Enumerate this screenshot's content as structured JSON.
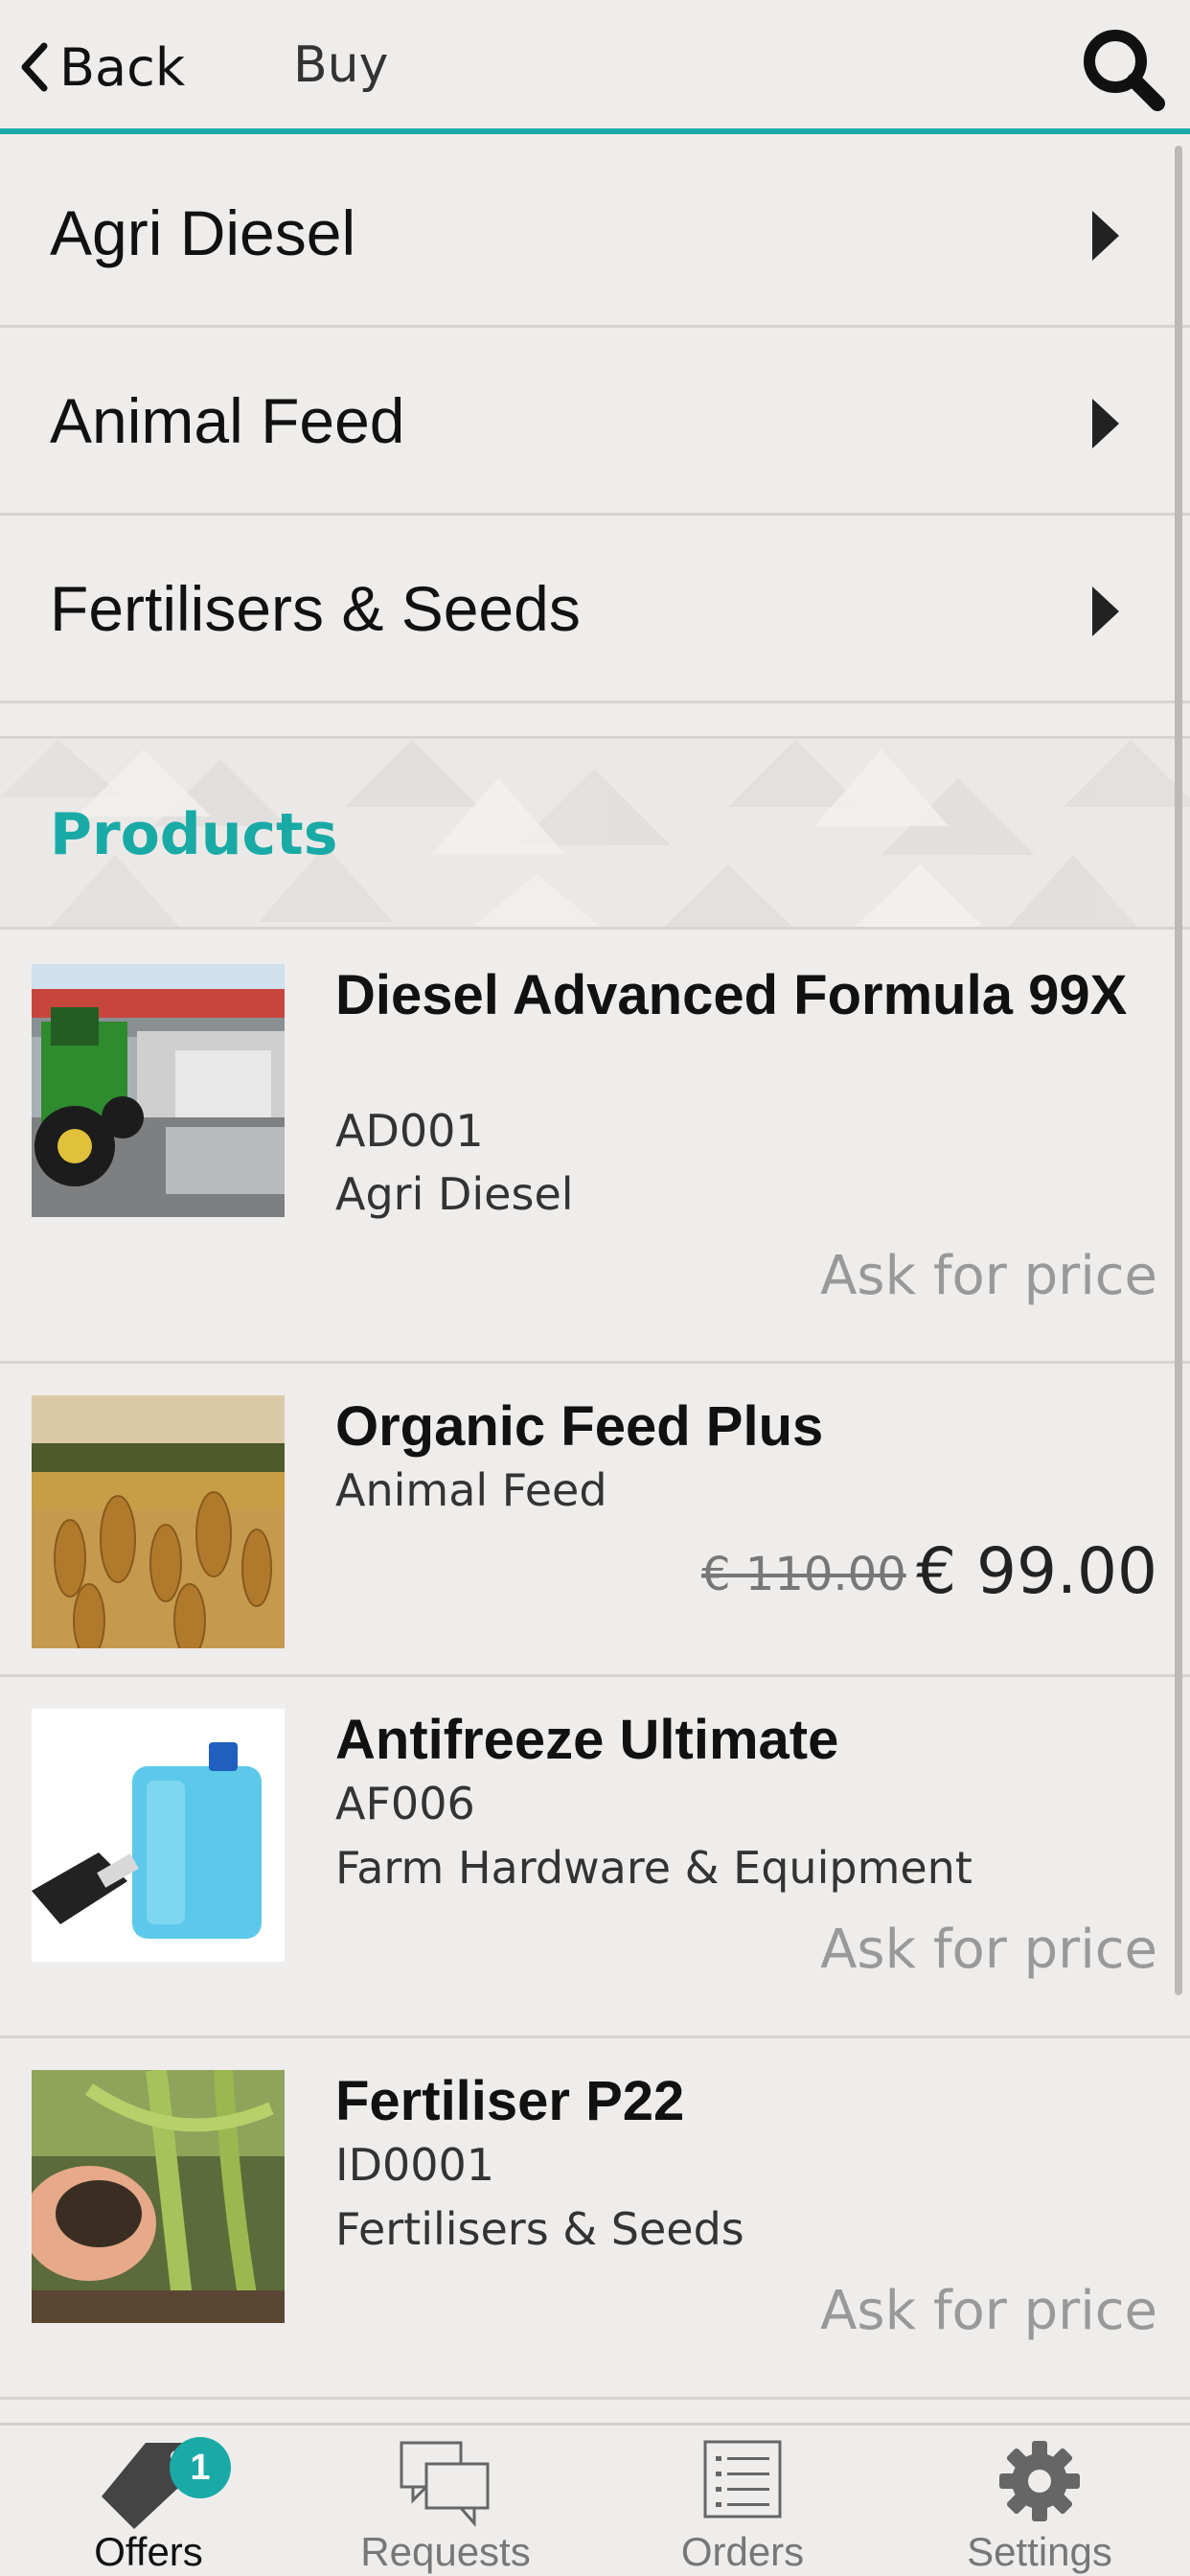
{
  "header": {
    "back_label": "Back",
    "title": "Buy",
    "search_icon": "search-icon"
  },
  "categories": [
    {
      "label": "Agri Diesel"
    },
    {
      "label": "Animal Feed"
    },
    {
      "label": "Fertilisers & Seeds"
    }
  ],
  "products_section": {
    "title": "Products"
  },
  "products": [
    {
      "name": "Diesel Advanced Formula 99X",
      "code": "AD001",
      "category": "Agri Diesel",
      "price_text": "Ask for price",
      "image": "tractor-refuelling-photo"
    },
    {
      "name": "Organic Feed Plus",
      "category": "Animal Feed",
      "old_price": "€ 110.00",
      "price": "€ 99.00",
      "image": "wheat-field-photo"
    },
    {
      "name": "Antifreeze Ultimate",
      "code": "AF006",
      "category": "Farm Hardware & Equipment",
      "price_text": "Ask for price",
      "image": "antifreeze-canister-photo"
    },
    {
      "name": "Fertiliser P22",
      "code": "ID0001",
      "category": "Fertilisers & Seeds",
      "price_text": "Ask for price",
      "image": "fertiliser-granules-photo"
    }
  ],
  "tabbar": {
    "tabs": [
      {
        "label": "Offers",
        "icon": "tag-icon",
        "active": true,
        "badge": "1"
      },
      {
        "label": "Requests",
        "icon": "chat-bubbles-icon"
      },
      {
        "label": "Orders",
        "icon": "list-icon"
      },
      {
        "label": "Settings",
        "icon": "gear-icon"
      }
    ]
  },
  "colors": {
    "accent": "#19aaa6",
    "background": "#efedeb",
    "divider": "#d7d5d3"
  }
}
